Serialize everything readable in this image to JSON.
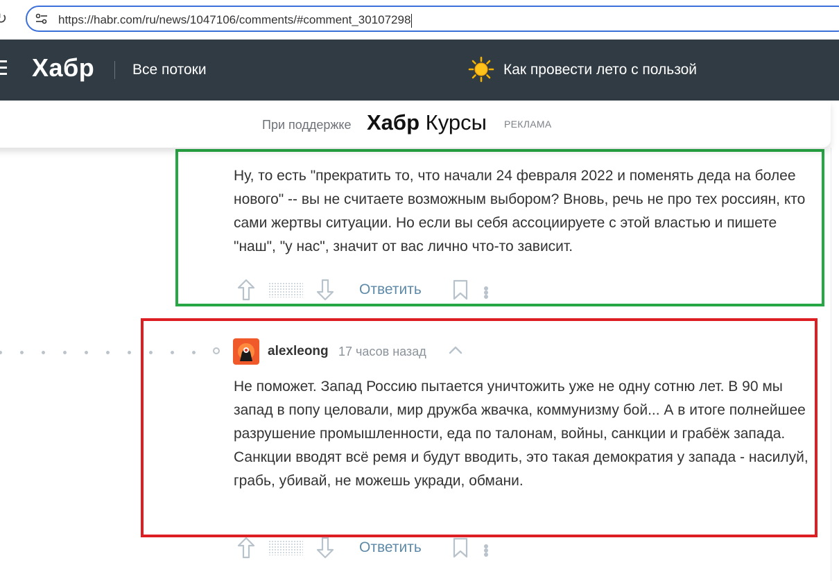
{
  "browser": {
    "url": "https://habr.com/ru/news/1047106/comments/#comment_30107298",
    "reload_icon": "reload-icon",
    "site_settings_icon": "tune-icon"
  },
  "header": {
    "logo": "Хабр",
    "flows_label": "Все потоки",
    "promo_label": "Как провести лето с пользой",
    "promo_icon": "sun-icon",
    "menu_icon": "hamburger-menu-icon",
    "background": "#303b44"
  },
  "sponsor": {
    "support_text": "При поддержке",
    "logo_bold": "Хабр",
    "logo_rest": "Курсы",
    "ad_label": "РЕКЛАМА"
  },
  "comments": [
    {
      "text": "Ну, то есть \"прекратить то, что начали 24 февраля 2022 и поменять деда на более нового\" -- вы не считаете возможным выбором? Вновь, речь не про тех россиян, кто сами жертвы ситуации. Но если вы себя ассоциируете с этой властью и пишете \"наш\", \"у нас\", значит от вас лично что-то зависит.",
      "reply_label": "Ответить",
      "highlight_color": "#27a844"
    },
    {
      "author": "alexleong",
      "time": "17 часов назад",
      "text": "Не поможет. Запад Россию пытается уничтожить уже не одну сотню лет. В 90 мы запад в попу целовали, мир дружба жвачка, коммунизму бой... А в итоге полнейшее разрушение промышленности, еда по талонам, войны, санкции и грабёж запада. Санкции вводят всё ремя и будут вводить, это такая демократия у запада - насилуй, грабь, убивай, не можешь укради, обмани.",
      "reply_label": "Ответить",
      "highlight_color": "#dd1f23"
    }
  ],
  "colors": {
    "link": "#5e8aa8",
    "accent_blue": "#3b6fd9"
  }
}
